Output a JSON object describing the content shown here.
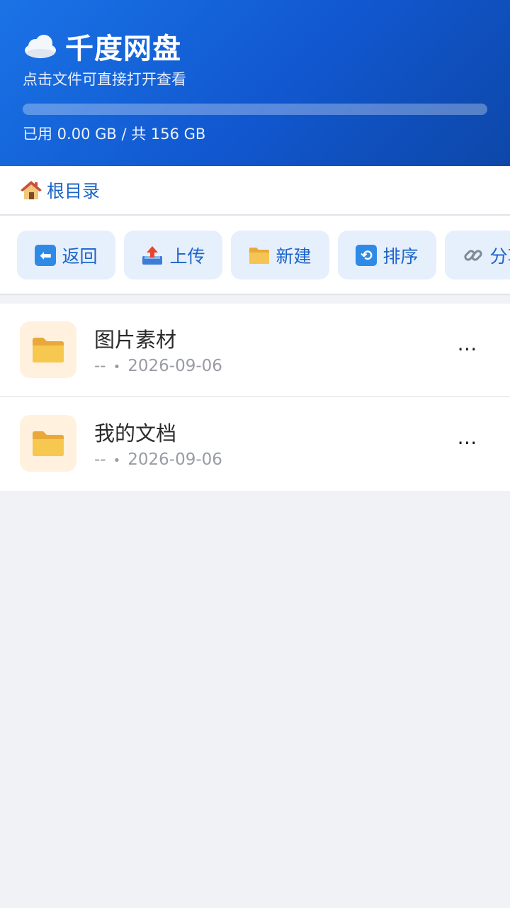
{
  "header": {
    "app_title": "千度网盘",
    "subtitle": "点击文件可直接打开查看",
    "storage_text": "已用 0.00 GB / 共 156 GB",
    "storage_used_fraction": 0
  },
  "breadcrumb": {
    "label": "根目录"
  },
  "toolbar": {
    "buttons": [
      {
        "label": "返回",
        "icon": "back-arrow-icon"
      },
      {
        "label": "上传",
        "icon": "upload-tray-icon"
      },
      {
        "label": "新建",
        "icon": "folder-icon"
      },
      {
        "label": "排序",
        "icon": "refresh-arrows-icon"
      },
      {
        "label": "分享",
        "icon": "link-icon"
      }
    ]
  },
  "files": [
    {
      "name": "图片素材",
      "size": "--",
      "date": "2026-09-06",
      "icon": "folder-icon"
    },
    {
      "name": "我的文档",
      "size": "--",
      "date": "2026-09-06",
      "icon": "folder-icon"
    }
  ],
  "more_label": "⋯",
  "meta_separator": "•",
  "colors": {
    "header_start": "#1a73e6",
    "header_end": "#0d47a8",
    "accent": "#1b64c8",
    "button_bg": "#e6effc",
    "folder_tile_bg": "#fff1dd",
    "page_bg": "#f0f2f6"
  }
}
